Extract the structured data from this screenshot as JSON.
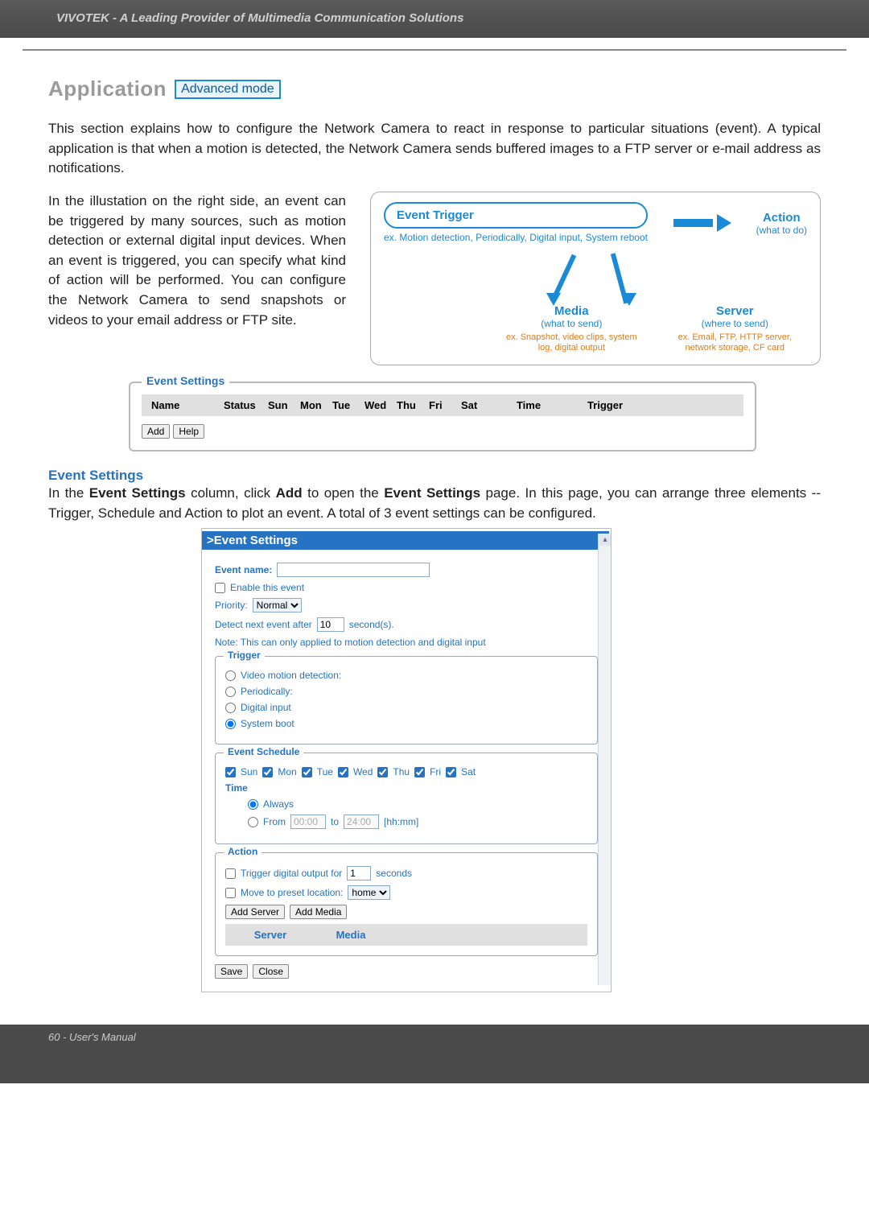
{
  "header": {
    "brand": "VIVOTEK - A Leading Provider of Multimedia Communication Solutions"
  },
  "title_row": {
    "app": "Application",
    "badge": "Advanced mode"
  },
  "intro_para": "This section explains how to configure the Network Camera to react in response to particular situations (event). A typical application is that when a motion is detected, the Network Camera sends buffered images to a FTP server or e-mail address as notifications.",
  "illus_para": "In the illustation on the right side, an event can be triggered by many sources, such as motion detection or external digital input devices. When an event is triggered, you can specify what kind of action will be performed. You can configure the Network Camera to send snapshots or videos to your email address or FTP site.",
  "diagram": {
    "event_trigger": "Event Trigger",
    "action": "Action",
    "action_sub": "(what to do)",
    "ex_trigger": "ex. Motion detection, Periodically, Digital input, System reboot",
    "media": "Media",
    "media_sub": "(what to send)",
    "server": "Server",
    "server_sub": "(where to send)",
    "ex_media": "ex. Snapshot, video clips, system log, digital output",
    "ex_server": "ex. Email, FTP, HTTP server, network storage, CF card"
  },
  "event_list_panel": {
    "legend": "Event Settings",
    "cols": [
      "Name",
      "Status",
      "Sun",
      "Mon",
      "Tue",
      "Wed",
      "Thu",
      "Fri",
      "Sat",
      "Time",
      "Trigger"
    ],
    "add": "Add",
    "help": "Help"
  },
  "event_section": {
    "heading": "Event Settings",
    "para_prefix": "In the ",
    "b1": "Event Settings",
    "mid1": " column, click ",
    "b2": "Add",
    "mid2": " to open the ",
    "b3": "Event Settings",
    "suffix": " page. In this page, you can arrange three elements -- Trigger, Schedule and Action to plot an event. A total of 3 event settings can be configured."
  },
  "es_dialog": {
    "title": ">Event Settings",
    "event_name_label": "Event name:",
    "event_name_value": "",
    "enable_label": "Enable this event",
    "priority_label": "Priority:",
    "priority_value": "Normal",
    "detect_label_pre": "Detect next event after",
    "detect_value": "10",
    "detect_label_post": "second(s).",
    "note": "Note: This can only applied to motion detection and digital input",
    "trigger": {
      "legend": "Trigger",
      "opt1": "Video motion detection:",
      "opt2": "Periodically:",
      "opt3": "Digital input",
      "opt4": "System boot"
    },
    "schedule": {
      "legend": "Event Schedule",
      "days": [
        "Sun",
        "Mon",
        "Tue",
        "Wed",
        "Thu",
        "Fri",
        "Sat"
      ],
      "time_label": "Time",
      "always": "Always",
      "from": "From",
      "from_val": "00:00",
      "to": "to",
      "to_val": "24:00",
      "hhmm": "[hh:mm]"
    },
    "action": {
      "legend": "Action",
      "trig_out_pre": "Trigger digital output for",
      "trig_out_val": "1",
      "trig_out_post": "seconds",
      "move_pre": "Move to preset location:",
      "move_val": "home",
      "add_server": "Add Server",
      "add_media": "Add Media",
      "col_server": "Server",
      "col_media": "Media"
    },
    "save": "Save",
    "close": "Close"
  },
  "footer": "60 - User's Manual"
}
